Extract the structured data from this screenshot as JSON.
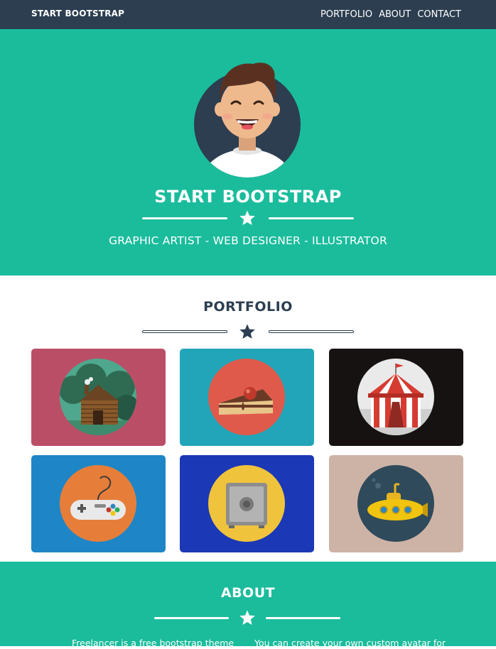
{
  "navbar": {
    "brand": "START BOOTSTRAP",
    "links": [
      "PORTFOLIO",
      "ABOUT",
      "CONTACT"
    ]
  },
  "hero": {
    "title": "START BOOTSTRAP",
    "subtitle": "GRAPHIC ARTIST - WEB DESIGNER - ILLUSTRATOR"
  },
  "portfolio": {
    "title": "PORTFOLIO",
    "items": [
      {
        "icon": "cabin-icon",
        "bg": "#bb4e67"
      },
      {
        "icon": "cake-icon",
        "bg": "#22a5b8"
      },
      {
        "icon": "circus-tent-icon",
        "bg": "#161212"
      },
      {
        "icon": "game-controller-icon",
        "bg": "#1e86c6"
      },
      {
        "icon": "safe-icon",
        "bg": "#1b38b6"
      },
      {
        "icon": "submarine-icon",
        "bg": "#cdb3a6"
      }
    ]
  },
  "about": {
    "title": "ABOUT",
    "col1": "Freelancer is a free bootstrap theme",
    "col2": "You can create your own custom avatar for"
  },
  "colors": {
    "primary": "#1abc9c",
    "secondary": "#2c3e50"
  }
}
